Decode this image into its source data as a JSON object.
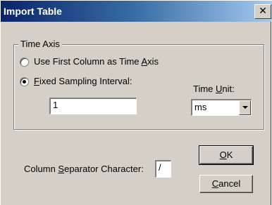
{
  "window": {
    "title": "Import Table",
    "close_glyph": "✕"
  },
  "time_axis": {
    "legend": "Time Axis",
    "options": [
      {
        "label_pre": "Use First Column as Time ",
        "label_u": "A",
        "label_post": "xis",
        "checked": false
      },
      {
        "label_pre": "",
        "label_u": "F",
        "label_post": "ixed Sampling Interval:",
        "checked": true
      }
    ],
    "interval_value": "1",
    "time_unit_label_pre": "Time ",
    "time_unit_label_u": "U",
    "time_unit_label_post": "nit:",
    "time_unit_value": "ms"
  },
  "separator": {
    "label_pre": "Column ",
    "label_u": "S",
    "label_post": "eparator Character:",
    "value": "/"
  },
  "buttons": {
    "ok_u": "O",
    "ok_post": "K",
    "cancel_u": "C",
    "cancel_post": "ancel"
  }
}
